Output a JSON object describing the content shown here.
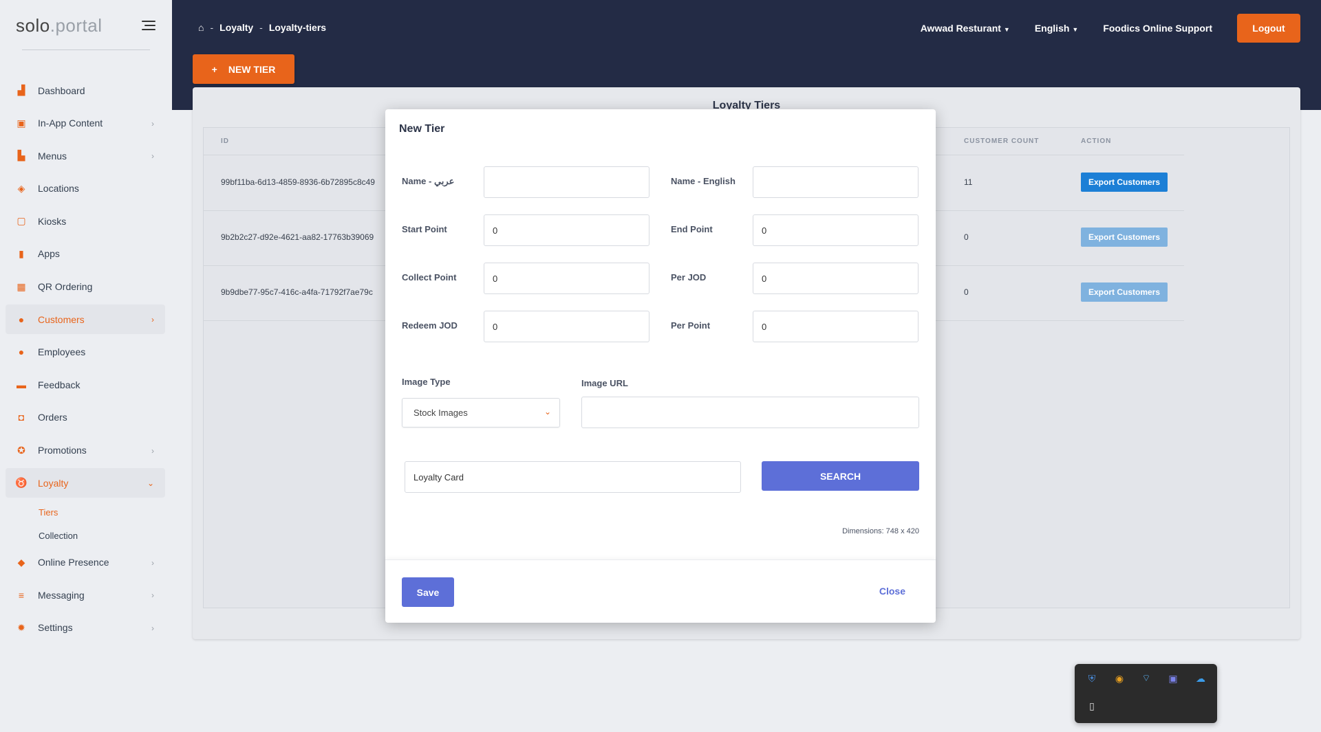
{
  "app": {
    "logo_left": "solo",
    "logo_right": "portal"
  },
  "sidebar": {
    "items": [
      {
        "label": "Dashboard",
        "icon": "chart-icon",
        "chevron": false
      },
      {
        "label": "In-App Content",
        "icon": "images-icon",
        "chevron": true
      },
      {
        "label": "Menus",
        "icon": "book-icon",
        "chevron": true
      },
      {
        "label": "Locations",
        "icon": "map-icon",
        "chevron": false
      },
      {
        "label": "Kiosks",
        "icon": "tablet-icon",
        "chevron": false
      },
      {
        "label": "Apps",
        "icon": "mobile-icon",
        "chevron": false
      },
      {
        "label": "QR Ordering",
        "icon": "qr-icon",
        "chevron": false
      },
      {
        "label": "Customers",
        "icon": "user-icon",
        "chevron": true
      },
      {
        "label": "Employees",
        "icon": "user-icon",
        "chevron": false
      },
      {
        "label": "Feedback",
        "icon": "comment-icon",
        "chevron": false
      },
      {
        "label": "Orders",
        "icon": "bag-icon",
        "chevron": false
      },
      {
        "label": "Promotions",
        "icon": "percent-icon",
        "chevron": true
      },
      {
        "label": "Loyalty",
        "icon": "medal-icon",
        "chevron": true
      },
      {
        "label": "Online Presence",
        "icon": "tags-icon",
        "chevron": true
      },
      {
        "label": "Messaging",
        "icon": "list-icon",
        "chevron": true
      },
      {
        "label": "Settings",
        "icon": "gear-icon",
        "chevron": true
      }
    ],
    "loyalty_sub": [
      "Tiers",
      "Collection"
    ]
  },
  "header": {
    "breadcrumb": [
      "Loyalty",
      "Loyalty-tiers"
    ],
    "restaurant": "Awwad Resturant",
    "language": "English",
    "support": "Foodics Online Support",
    "logout": "Logout",
    "new_tier": "NEW TIER"
  },
  "table": {
    "title": "Loyalty Tiers",
    "columns": [
      "ID",
      "CUSTOMER COUNT",
      "ACTION"
    ],
    "rows": [
      {
        "id": "99bf11ba-6d13-4859-8936-6b72895c8c49",
        "count": "11",
        "action": "Export Customers"
      },
      {
        "id": "9b2b2c27-d92e-4621-aa82-17763b39069",
        "count": "0",
        "action": "Export Customers"
      },
      {
        "id": "9b9dbe77-95c7-416c-a4fa-71792f7ae79c",
        "count": "0",
        "action": "Export Customers"
      }
    ]
  },
  "modal": {
    "title": "New Tier",
    "name_ar_label": "Name - عربي",
    "name_en_label": "Name - English",
    "name_ar_value": "",
    "name_en_value": "",
    "start_point_label": "Start Point",
    "start_point_value": "0",
    "end_point_label": "End Point",
    "end_point_value": "0",
    "collect_point_label": "Collect Point",
    "collect_point_value": "0",
    "per_jod_label": "Per JOD",
    "per_jod_value": "0",
    "redeem_jod_label": "Redeem JOD",
    "redeem_jod_value": "0",
    "per_point_label": "Per Point",
    "per_point_value": "0",
    "image_type_label": "Image Type",
    "image_type_value": "Stock Images",
    "image_url_label": "Image URL",
    "image_url_value": "",
    "search_value": "Loyalty Card",
    "search_button": "SEARCH",
    "dimensions": "Dimensions: 748 x 420",
    "save": "Save",
    "close": "Close"
  },
  "colors": {
    "accent": "#e8641b",
    "header": "#232b45",
    "primary": "#5d6fd8",
    "export": "#1c7fd6"
  }
}
